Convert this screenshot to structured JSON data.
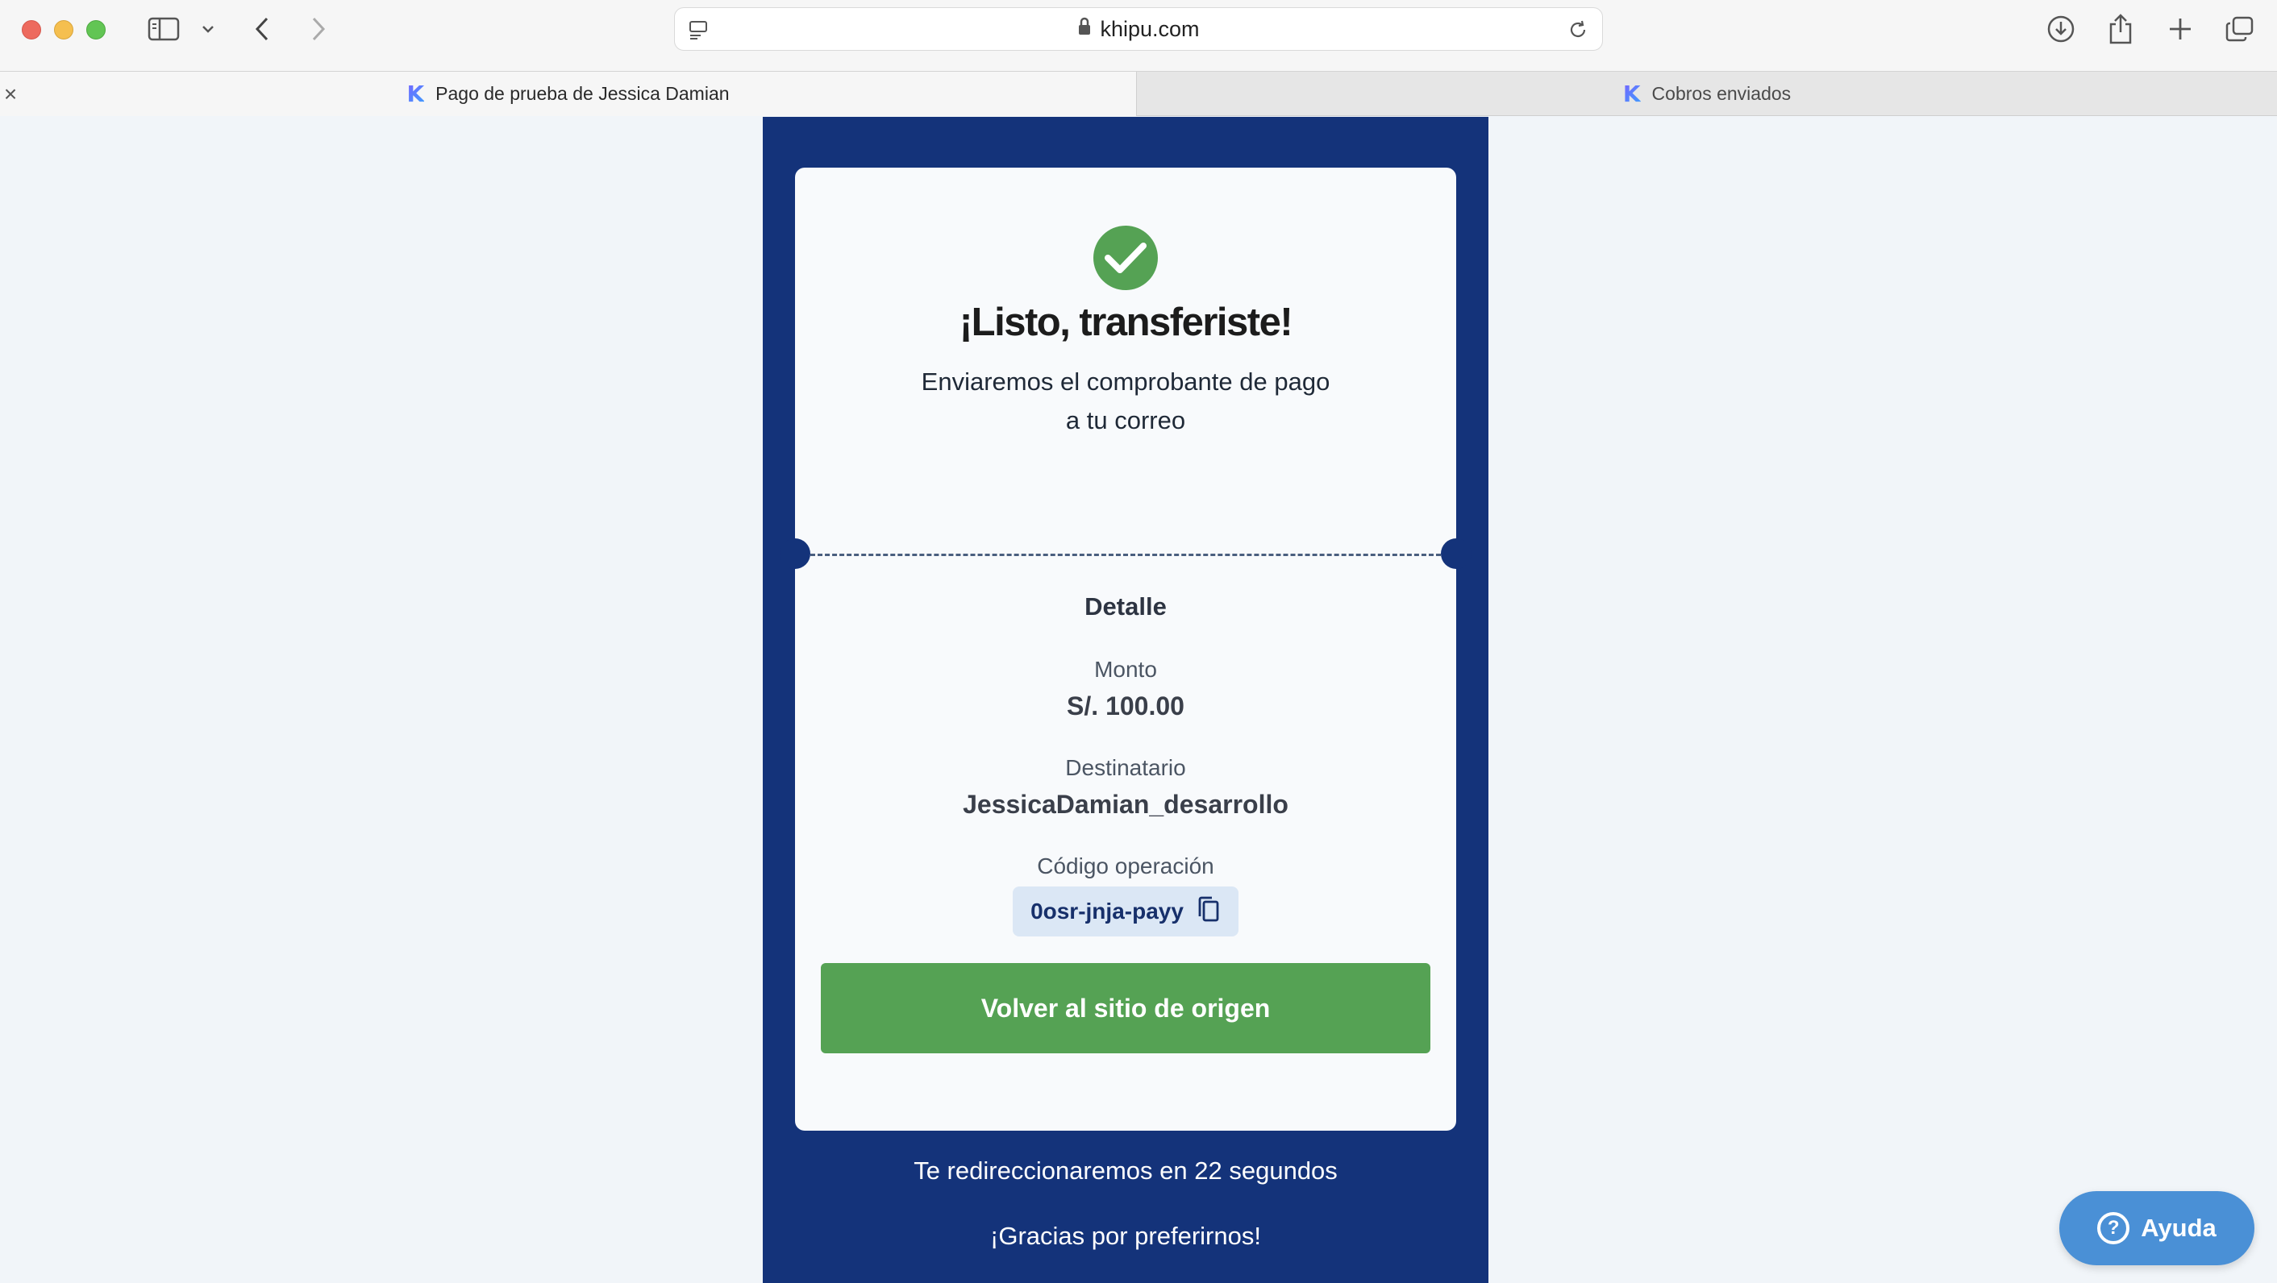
{
  "browser": {
    "url": "khipu.com",
    "tabs": [
      {
        "title": "Pago de prueba de Jessica Damian",
        "active": true
      },
      {
        "title": "Cobros enviados",
        "active": false
      }
    ],
    "tab_close_glyph": "×",
    "favicon_letter": "K"
  },
  "receipt": {
    "title": "¡Listo, transferiste!",
    "subtitle_line1": "Enviaremos el comprobante de pago",
    "subtitle_line2": "a tu correo",
    "detail_heading": "Detalle",
    "amount_label": "Monto",
    "amount_value": "S/. 100.00",
    "recipient_label": "Destinatario",
    "recipient_value": "JessicaDamian_desarrollo",
    "operation_label": "Código operación",
    "operation_code": "0osr-jnja-payy",
    "return_button": "Volver al sitio de origen"
  },
  "footer": {
    "redirect_text": "Te redireccionaremos en 22 segundos",
    "thanks_text": "¡Gracias por preferirnos!"
  },
  "help_button": {
    "label": "Ayuda",
    "icon_glyph": "?"
  },
  "colors": {
    "panel_blue": "#14337a",
    "success_green": "#55a254",
    "help_blue": "#4a90d6",
    "chip_bg": "#dbe7f5"
  },
  "icons": [
    "sidebar-icon",
    "chevron-down-icon",
    "back-icon",
    "forward-icon",
    "page-menu-icon",
    "lock-icon",
    "reload-icon",
    "download-icon",
    "share-icon",
    "new-tab-icon",
    "tab-overview-icon",
    "close-icon",
    "checkmark-icon",
    "copy-icon",
    "help-icon"
  ]
}
